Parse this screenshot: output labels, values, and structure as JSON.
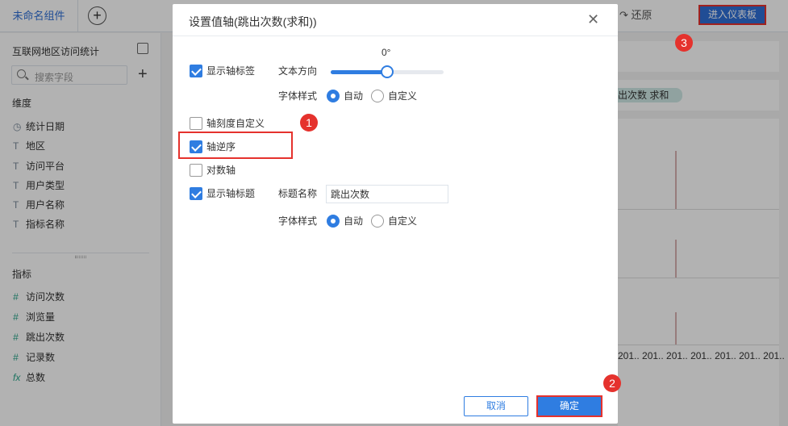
{
  "app": {
    "tab_label": "未命名组件",
    "add_icon": "plus-circle-icon",
    "restore_label": "↷ 还原",
    "enter_dashboard": "进入仪表板"
  },
  "sidebar": {
    "dataset_title": "互联网地区访问统计",
    "search_placeholder": "搜索字段",
    "dimensions_label": "维度",
    "dimensions": [
      {
        "icon": "◷",
        "label": "统计日期"
      },
      {
        "icon": "T",
        "label": "地区"
      },
      {
        "icon": "T",
        "label": "访问平台"
      },
      {
        "icon": "T",
        "label": "用户类型"
      },
      {
        "icon": "T",
        "label": "用户名称"
      },
      {
        "icon": "T",
        "label": "指标名称"
      }
    ],
    "measures_label": "指标",
    "measures": [
      {
        "icon": "#",
        "label": "访问次数"
      },
      {
        "icon": "#",
        "label": "浏览量"
      },
      {
        "icon": "#",
        "label": "跳出次数"
      },
      {
        "icon": "#",
        "label": "记录数"
      },
      {
        "icon": "fx",
        "label": "总数"
      }
    ]
  },
  "right": {
    "pill_text": "出次数  求和",
    "x_labels": "201.. 201.. 201.. 201.. 201.. 201.. 201.."
  },
  "dialog": {
    "title": "设置值轴(跳出次数(求和))",
    "close_icon": "close-icon",
    "show_axis_label": "显示轴标签",
    "text_direction_label": "文本方向",
    "degree": "0°",
    "rotation_fraction": 0.5,
    "font_style_label_1": "字体样式",
    "auto_label_1": "自动",
    "custom_label_1": "自定义",
    "custom_scale": "轴刻度自定义",
    "reverse_axis": "轴逆序",
    "log_axis": "对数轴",
    "show_axis_title": "显示轴标题",
    "title_name_label": "标题名称",
    "title_name_value": "跳出次数",
    "font_style_label_2": "字体样式",
    "auto_label_2": "自动",
    "custom_label_2": "自定义",
    "cancel": "取消",
    "ok": "确定"
  },
  "badges": {
    "one": "1",
    "two": "2",
    "three": "3"
  },
  "colors": {
    "accent": "#2f7de1",
    "highlight": "#e5322d"
  }
}
